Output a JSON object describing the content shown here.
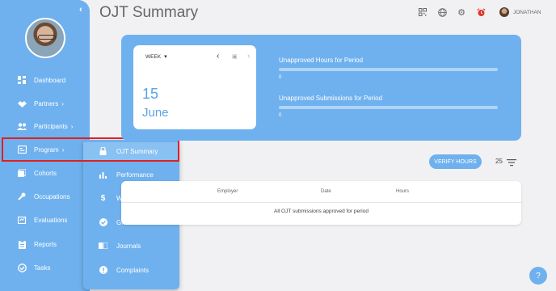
{
  "page": {
    "title": "OJT Summary"
  },
  "header": {
    "user_name": "JONATHAN",
    "icons": [
      "qr-code-icon",
      "globe-icon",
      "gear-icon",
      "alarm-icon"
    ]
  },
  "sidebar": {
    "items": [
      {
        "label": "Dashboard",
        "icon": "dashboard-icon"
      },
      {
        "label": "Partners",
        "icon": "handshake-icon",
        "chevron": "›"
      },
      {
        "label": "Participants",
        "icon": "people-icon",
        "chevron": "›"
      },
      {
        "label": "Program",
        "icon": "program-icon",
        "chevron": "›"
      },
      {
        "label": "Cohorts",
        "icon": "cohorts-icon"
      },
      {
        "label": "Occupations",
        "icon": "wrench-icon"
      },
      {
        "label": "Evaluations",
        "icon": "evaluations-icon"
      },
      {
        "label": "Reports",
        "icon": "clipboard-icon"
      },
      {
        "label": "Tasks",
        "icon": "check-circle-icon"
      }
    ]
  },
  "submenu": {
    "items": [
      {
        "label": "OJT Summary",
        "icon": "lock-icon",
        "active": true
      },
      {
        "label": "Performance",
        "icon": "bar-chart-icon"
      },
      {
        "label": "Wages",
        "icon": "dollar-icon"
      },
      {
        "label": "Grades",
        "icon": "check-badge-icon"
      },
      {
        "label": "Journals",
        "icon": "journal-icon"
      },
      {
        "label": "Complaints",
        "icon": "alert-icon"
      }
    ]
  },
  "date_card": {
    "period": "WEEK",
    "day": "15",
    "month": "June"
  },
  "stats": [
    {
      "label": "Unapproved Hours for Period",
      "value": "0"
    },
    {
      "label": "Unapproved Submissions for Period",
      "value": "0"
    }
  ],
  "actions": {
    "verify_label": "VERIFY HOURS",
    "page_size": "25"
  },
  "table": {
    "columns": [
      "Employer",
      "Date",
      "Hours"
    ],
    "empty_message": "All OJT submissions approved for period"
  },
  "colors": {
    "accent": "#6fb1ee",
    "highlight": "#e02020"
  }
}
